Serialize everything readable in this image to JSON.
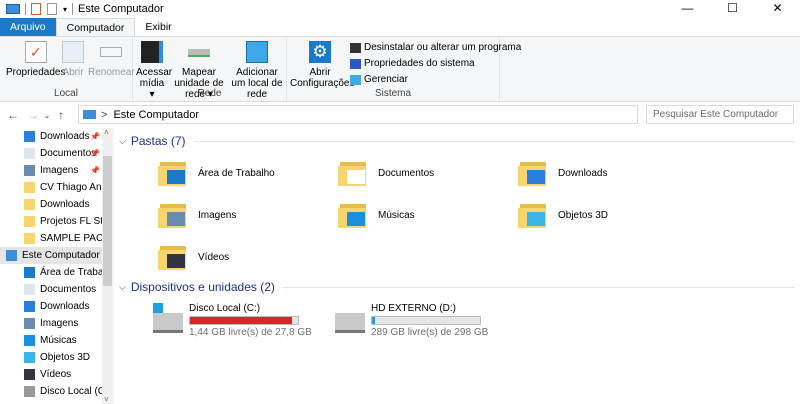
{
  "window": {
    "title": "Este Computador",
    "minimize": "—",
    "maximize": "☐",
    "close": "✕"
  },
  "tabs": [
    "Arquivo",
    "Computador",
    "Exibir"
  ],
  "ribbon": {
    "local": {
      "label": "Local",
      "buttons": [
        "Propriedades",
        "Abrir",
        "Renomear"
      ]
    },
    "rede": {
      "label": "Rede",
      "buttons": [
        "Acessar mídia ▾",
        "Mapear unidade de rede ▾",
        "Adicionar um local de rede"
      ]
    },
    "sistema": {
      "label": "Sistema",
      "open_settings": "Abrir Configurações",
      "links": [
        "Desinstalar ou alterar um programa",
        "Propriedades do sistema",
        "Gerenciar"
      ]
    }
  },
  "address": {
    "path": "Este Computador",
    "separator": ">",
    "search_placeholder": "Pesquisar Este Computador"
  },
  "sidebar": {
    "items": [
      {
        "label": "Downloads",
        "icon": "download-arrow-icon",
        "pinned": true
      },
      {
        "label": "Documentos",
        "icon": "document-icon",
        "pinned": true
      },
      {
        "label": "Imagens",
        "icon": "image-icon",
        "pinned": true
      },
      {
        "label": "CV Thiago Andri",
        "icon": "folder-icon"
      },
      {
        "label": "Downloads",
        "icon": "folder-icon"
      },
      {
        "label": "Projetos FL Stud",
        "icon": "folder-icon"
      },
      {
        "label": "SAMPLE PACKS .",
        "icon": "folder-icon"
      },
      {
        "label": "Este Computador",
        "icon": "computer-icon",
        "pc": true
      },
      {
        "label": "Área de Trabalho",
        "icon": "desktop-icon"
      },
      {
        "label": "Documentos",
        "icon": "document-icon"
      },
      {
        "label": "Downloads",
        "icon": "download-arrow-icon"
      },
      {
        "label": "Imagens",
        "icon": "image-icon"
      },
      {
        "label": "Músicas",
        "icon": "music-icon"
      },
      {
        "label": "Objetos 3D",
        "icon": "cube-icon"
      },
      {
        "label": "Vídeos",
        "icon": "video-icon"
      },
      {
        "label": "Disco Local (C:)",
        "icon": "drive-icon"
      }
    ]
  },
  "folders_header": "Pastas (7)",
  "folders": [
    "Área de Trabalho",
    "Documentos",
    "Downloads",
    "Imagens",
    "Músicas",
    "Objetos 3D",
    "Vídeos"
  ],
  "devices_header": "Dispositivos e unidades (2)",
  "drives": [
    {
      "name": "Disco Local (C:)",
      "free": "1,44 GB livre(s) de 27,8 GB",
      "used_fraction": 0.948,
      "color": "#da2626"
    },
    {
      "name": "HD EXTERNO (D:)",
      "free": "289 GB livre(s) de 298 GB",
      "used_fraction": 0.03,
      "color": "#26a0da"
    }
  ]
}
